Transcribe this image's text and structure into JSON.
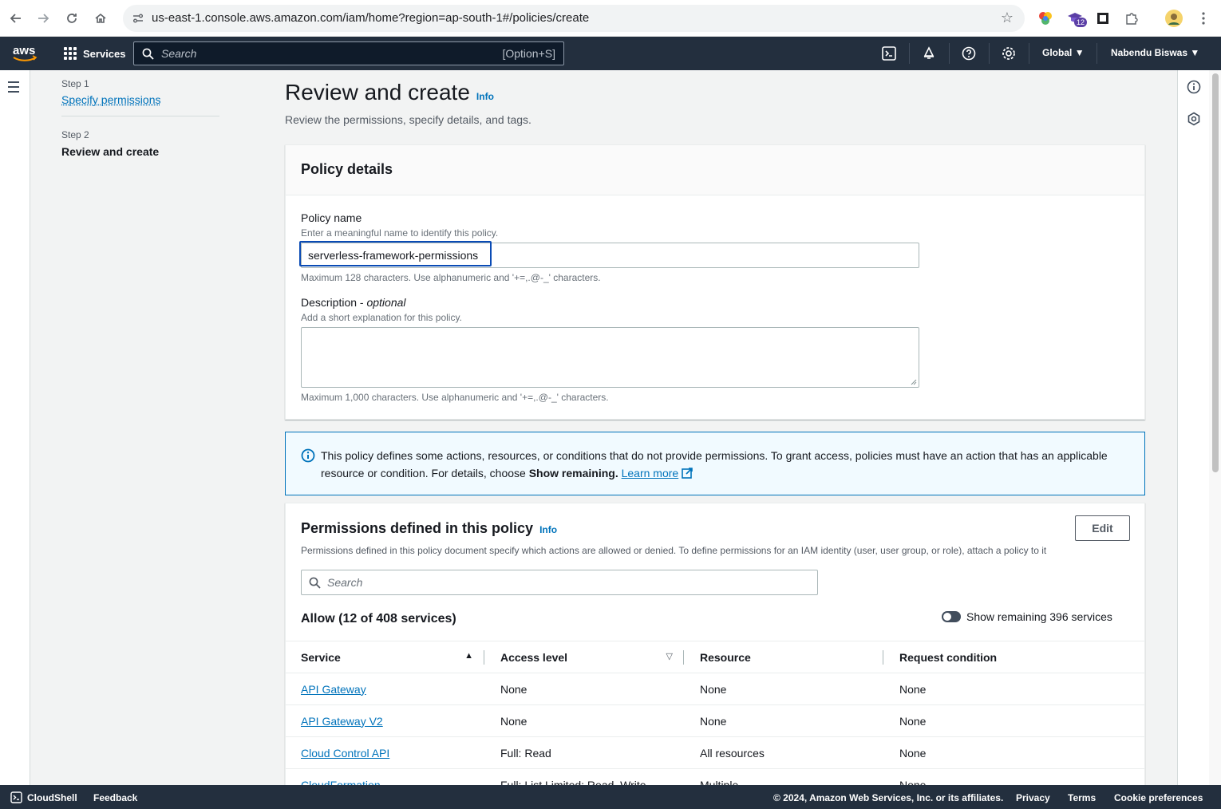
{
  "browser": {
    "url": "us-east-1.console.aws.amazon.com/iam/home?region=ap-south-1#/policies/create",
    "extension_badge": "12"
  },
  "aws_nav": {
    "logo_text": "aws",
    "services_label": "Services",
    "search_placeholder": "Search",
    "search_shortcut": "[Option+S]",
    "region_label": "Global",
    "user_label": "Nabendu Biswas"
  },
  "steps": [
    {
      "label": "Step 1",
      "title": "Specify permissions"
    },
    {
      "label": "Step 2",
      "title": "Review and create"
    }
  ],
  "page": {
    "title": "Review and create",
    "info": "Info",
    "subtitle": "Review the permissions, specify details, and tags."
  },
  "policy_details": {
    "heading": "Policy details",
    "name_label": "Policy name",
    "name_desc": "Enter a meaningful name to identify this policy.",
    "name_value": "serverless-framework-permissions",
    "name_constraint": "Maximum 128 characters. Use alphanumeric and '+=,.@-_' characters.",
    "description_label": "Description - ",
    "description_optional": "optional",
    "description_desc": "Add a short explanation for this policy.",
    "description_value": "",
    "description_constraint": "Maximum 1,000 characters. Use alphanumeric and '+=,.@-_' characters."
  },
  "alert": {
    "text_before": "This policy defines some actions, resources, or conditions that do not provide permissions. To grant access, policies must have an action that has an applicable resource or condition. For details, choose ",
    "bold": "Show remaining.",
    "link": "Learn more"
  },
  "permissions": {
    "heading": "Permissions defined in this policy",
    "info": "Info",
    "edit_label": "Edit",
    "description": "Permissions defined in this policy document specify which actions are allowed or denied. To define permissions for an IAM identity (user, user group, or role), attach a policy to it",
    "search_placeholder": "Search",
    "allow_heading": "Allow (12 of 408 services)",
    "toggle_label": "Show remaining 396 services",
    "columns": [
      "Service",
      "Access level",
      "Resource",
      "Request condition"
    ],
    "rows": [
      {
        "service": "API Gateway",
        "access": "None",
        "resource": "None",
        "condition": "None"
      },
      {
        "service": "API Gateway V2",
        "access": "None",
        "resource": "None",
        "condition": "None"
      },
      {
        "service": "Cloud Control API",
        "access": "Full: Read",
        "resource": "All resources",
        "condition": "None"
      },
      {
        "service": "CloudFormation",
        "access": "Full: List Limited: Read, Write",
        "resource": "Multiple",
        "condition": "None"
      }
    ]
  },
  "footer": {
    "cloudshell": "CloudShell",
    "feedback": "Feedback",
    "copyright": "© 2024, Amazon Web Services, Inc. or its affiliates.",
    "privacy": "Privacy",
    "terms": "Terms",
    "cookies": "Cookie preferences"
  }
}
